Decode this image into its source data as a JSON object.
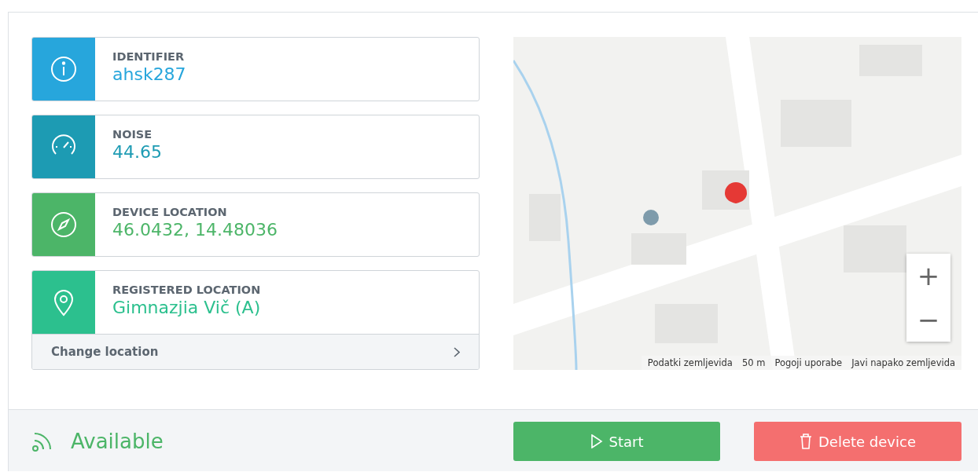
{
  "info_cards": [
    {
      "kind": "info",
      "label": "IDENTIFIER",
      "value": "ahsk287",
      "color": "#27a6dc"
    },
    {
      "kind": "gauge",
      "label": "NOISE",
      "value": "44.65",
      "color": "#1d9bb3"
    },
    {
      "kind": "compass",
      "label": "DEVICE LOCATION",
      "value": "46.0432, 14.48036",
      "color": "#4cb568"
    },
    {
      "kind": "pin",
      "label": "REGISTERED LOCATION",
      "value": "Gimnazjia Vič (A)",
      "color": "#2cc08e",
      "action": "Change location"
    }
  ],
  "map": {
    "kind": "picture",
    "zoom_in": "+",
    "zoom_out": "−",
    "attribution": [
      "Podatki zemljevida",
      "50 m",
      "Pogoji uporabe",
      "Javi napako zemljevida"
    ]
  },
  "footer": {
    "status": "Available",
    "start_button": "Start",
    "delete_button": "Delete device"
  }
}
